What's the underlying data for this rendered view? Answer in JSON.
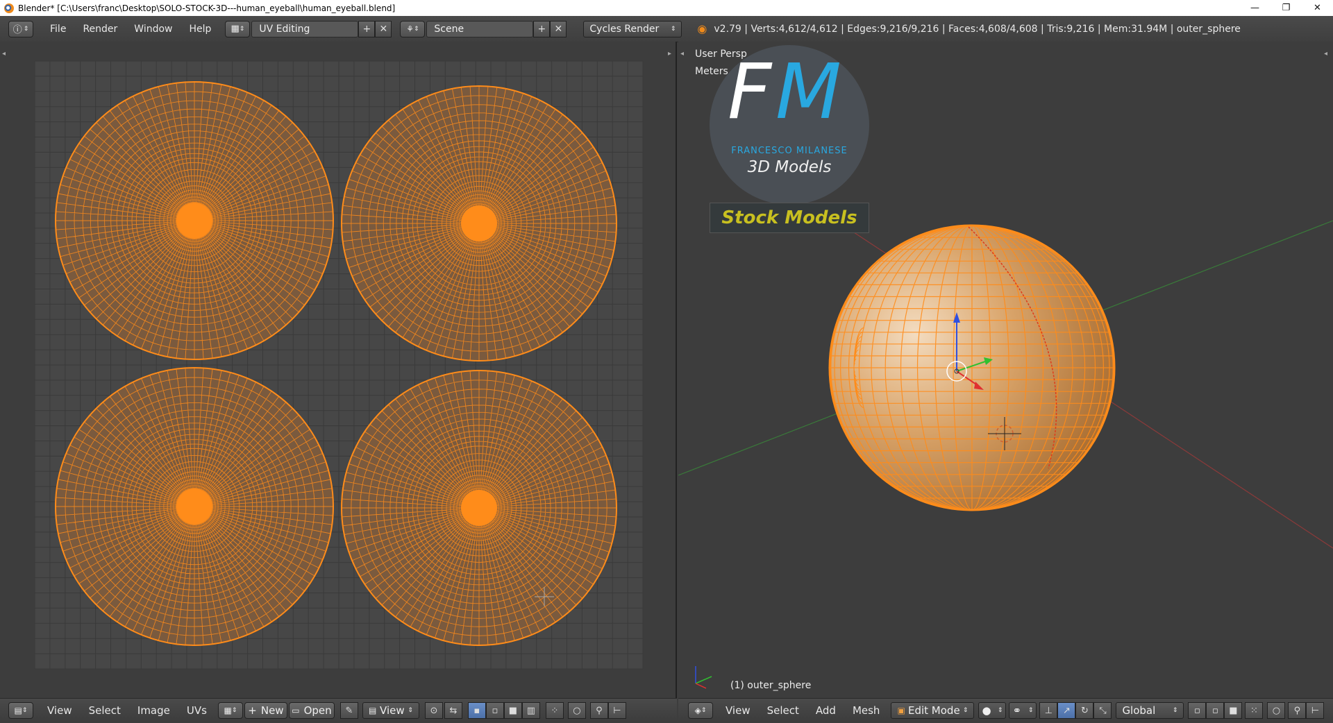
{
  "window": {
    "title": "Blender* [C:\\Users\\franc\\Desktop\\SOLO-STOCK-3D---human_eyeball\\human_eyeball.blend]",
    "minimize": "—",
    "maximize": "❐",
    "close": "✕"
  },
  "topbar": {
    "menus": [
      "File",
      "Render",
      "Window",
      "Help"
    ],
    "layout": "UV Editing",
    "scene": "Scene",
    "engine": "Cycles Render",
    "stats": "v2.79 | Verts:4,612/4,612 | Edges:9,216/9,216 | Faces:4,608/4,608 | Tris:9,216 | Mem:31.94M | outer_sphere"
  },
  "uv_editor": {
    "menus": [
      "View",
      "Select",
      "Image",
      "UVs"
    ],
    "new_label": "New",
    "open_label": "Open",
    "view_label": "View"
  },
  "viewport": {
    "view_name": "User Persp",
    "units": "Meters",
    "object_label": "(1) outer_sphere",
    "menus": [
      "View",
      "Select",
      "Add",
      "Mesh"
    ],
    "mode": "Edit Mode",
    "orientation": "Global"
  },
  "logo": {
    "initials_f": "F",
    "initials_m": "M",
    "brand": "FRANCESCO MILANESE",
    "tagline": "3D Models",
    "banner": "Stock Models"
  },
  "colors": {
    "uv_orange": "#ff8c1a",
    "mesh_fill": "#c89050",
    "bg": "#3d3d3d",
    "logo_blue": "#29a8e0",
    "banner_yellow": "#c8c020"
  }
}
